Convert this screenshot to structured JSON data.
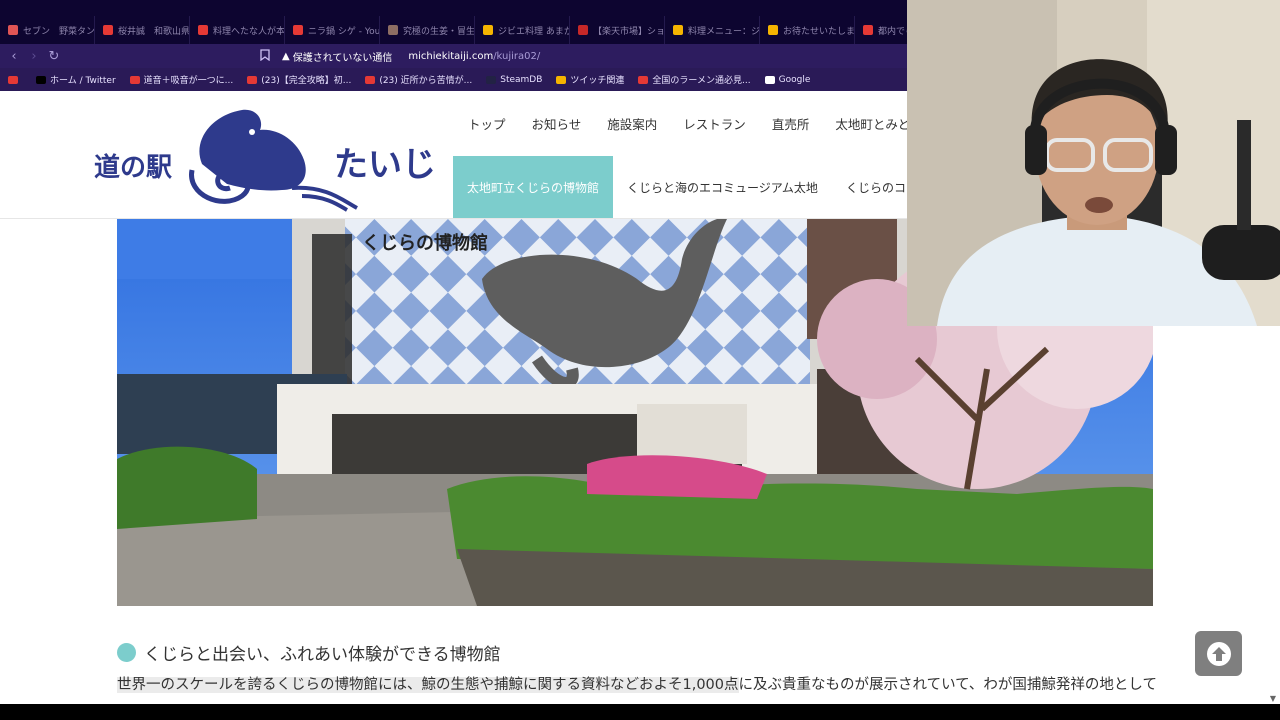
{
  "browser": {
    "tabs": [
      {
        "label": "セブン　野菜タン",
        "color": "#e05555"
      },
      {
        "label": "桜井誠　和歌山県",
        "color": "#e53935"
      },
      {
        "label": "料理へたな人が本",
        "color": "#e53935"
      },
      {
        "label": "ニラ鍋 シゲ - YouT",
        "color": "#e53935"
      },
      {
        "label": "究極の生姜・冒生",
        "color": "#8d6e63"
      },
      {
        "label": "ジビエ料理 あまかい",
        "color": "#f5b400"
      },
      {
        "label": "【楽天市場】ショウ",
        "color": "#c62828"
      },
      {
        "label": "料理メニュー：ジビ",
        "color": "#f5b400"
      },
      {
        "label": "お待たせいたしまし",
        "color": "#f5b400"
      },
      {
        "label": "都内でら",
        "color": "#e53935"
      }
    ],
    "nav": {
      "back": "‹",
      "forward": "›",
      "reload": "↻"
    },
    "security_label": "保護されていない通信",
    "url_host": "michiekitaiji.com",
    "url_path": "/kujira02/",
    "bookmarks": [
      {
        "label": "",
        "color": "#e53935"
      },
      {
        "label": "ホーム / Twitter",
        "color": "#000000"
      },
      {
        "label": "道音＋吸音が一つに...",
        "color": "#e53935"
      },
      {
        "label": "(23)【完全攻略】初...",
        "color": "#e53935"
      },
      {
        "label": "(23) 近所から苦情が...",
        "color": "#e53935"
      },
      {
        "label": "SteamDB",
        "color": "#222244"
      },
      {
        "label": "ツイッチ関連",
        "color": "#f5b400"
      },
      {
        "label": "全国のラーメン通必見...",
        "color": "#e53935"
      },
      {
        "label": "Google",
        "color": "#ffffff"
      }
    ]
  },
  "site": {
    "logo_text": "道の駅",
    "logo_script": "たいじ",
    "nav_top": [
      "トップ",
      "お知らせ",
      "施設案内",
      "レストラン",
      "直売所",
      "太地町とみどころ"
    ],
    "nav_sub": [
      "太地町立くじらの博物館",
      "くじらと海のエコミュージアム太地",
      "くじらのコラム"
    ],
    "museum_sign": "くじらの博物館",
    "heading": "くじらと出会い、ふれあい体験ができる博物館",
    "para_highlight": "世界一のスケールを誇るくじらの博物館には、鯨の生態や捕鯨に関する資料などおよそ1,000点",
    "para_rest": "に及ぶ貴重なものが展示されていて、わが国捕鯨発祥の地として昔",
    "accent": "#7ccdcc"
  }
}
